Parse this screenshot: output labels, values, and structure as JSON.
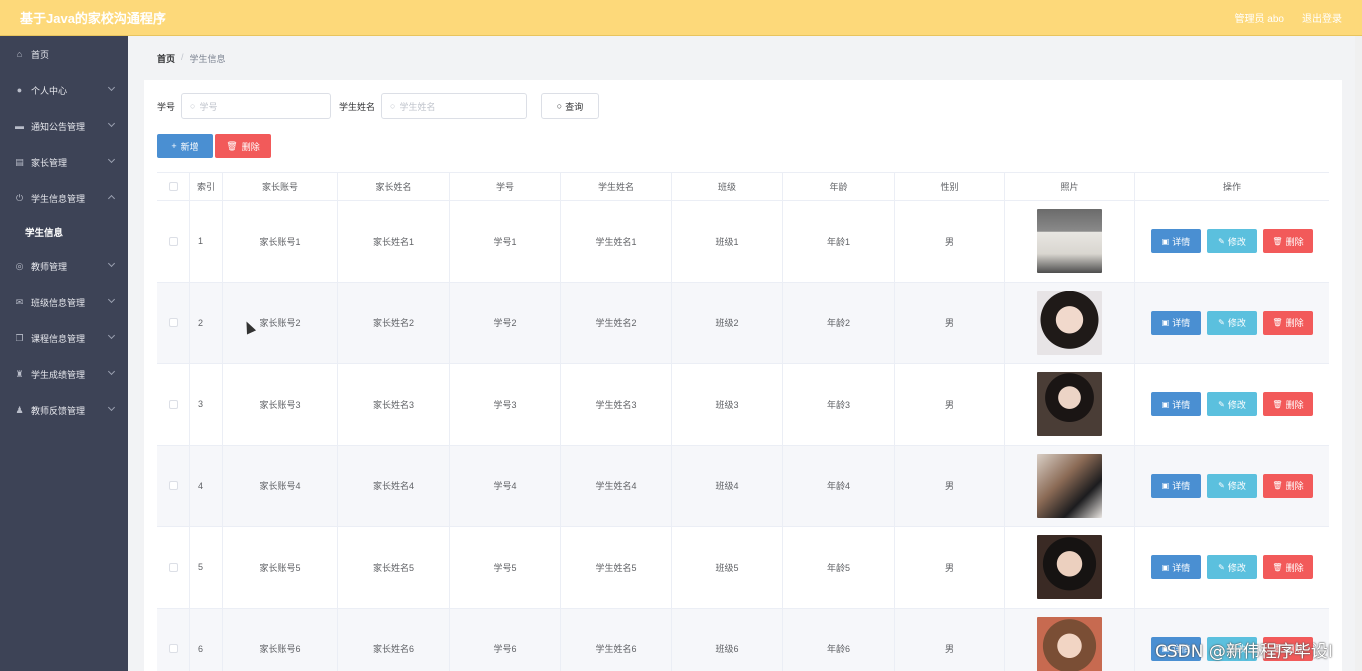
{
  "app": {
    "title": "基于Java的家校沟通程序",
    "user": "管理员 abo",
    "logout": "退出登录"
  },
  "sidebar": {
    "items": [
      {
        "label": "首页",
        "icon": "home-icon"
      },
      {
        "label": "个人中心",
        "icon": "user-icon"
      },
      {
        "label": "通知公告管理",
        "icon": "briefcase-icon"
      },
      {
        "label": "家长管理",
        "icon": "clipboard-icon"
      },
      {
        "label": "学生信息管理",
        "icon": "power-icon"
      },
      {
        "label": "教师管理",
        "icon": "compass-icon"
      },
      {
        "label": "班级信息管理",
        "icon": "mail-icon"
      },
      {
        "label": "课程信息管理",
        "icon": "copy-icon"
      },
      {
        "label": "学生成绩管理",
        "icon": "trophy-icon"
      },
      {
        "label": "教师反馈管理",
        "icon": "person-icon"
      }
    ],
    "sub_item": "学生信息"
  },
  "breadcrumb": {
    "home": "首页",
    "sep": "/",
    "current": "学生信息"
  },
  "search": {
    "label1": "学号",
    "placeholder1": "学号",
    "label2": "学生姓名",
    "placeholder2": "学生姓名",
    "query": "查询"
  },
  "actions": {
    "add": "新增",
    "delete": "删除"
  },
  "table": {
    "headers": [
      "索引",
      "家长账号",
      "家长姓名",
      "学号",
      "学生姓名",
      "班级",
      "年龄",
      "性别",
      "照片",
      "操作"
    ],
    "rows": [
      {
        "idx": "1",
        "parent_account": "家长账号1",
        "parent_name": "家长姓名1",
        "student_no": "学号1",
        "student_name": "学生姓名1",
        "class": "班级1",
        "age": "年龄1",
        "gender": "男"
      },
      {
        "idx": "2",
        "parent_account": "家长账号2",
        "parent_name": "家长姓名2",
        "student_no": "学号2",
        "student_name": "学生姓名2",
        "class": "班级2",
        "age": "年龄2",
        "gender": "男"
      },
      {
        "idx": "3",
        "parent_account": "家长账号3",
        "parent_name": "家长姓名3",
        "student_no": "学号3",
        "student_name": "学生姓名3",
        "class": "班级3",
        "age": "年龄3",
        "gender": "男"
      },
      {
        "idx": "4",
        "parent_account": "家长账号4",
        "parent_name": "家长姓名4",
        "student_no": "学号4",
        "student_name": "学生姓名4",
        "class": "班级4",
        "age": "年龄4",
        "gender": "男"
      },
      {
        "idx": "5",
        "parent_account": "家长账号5",
        "parent_name": "家长姓名5",
        "student_no": "学号5",
        "student_name": "学生姓名5",
        "class": "班级5",
        "age": "年龄5",
        "gender": "男"
      },
      {
        "idx": "6",
        "parent_account": "家长账号6",
        "parent_name": "家长姓名6",
        "student_no": "学号6",
        "student_name": "学生姓名6",
        "class": "班级6",
        "age": "年龄6",
        "gender": "男"
      }
    ],
    "row_actions": {
      "detail": "详情",
      "edit": "修改",
      "delete": "删除"
    }
  },
  "watermark": "CSDN @新伟程序毕设I",
  "colors": {
    "topbar": "#fdd97a",
    "sidebar": "#3d4356",
    "primary": "#4a8fd2",
    "info": "#5bc0de",
    "danger": "#f25a5a"
  }
}
